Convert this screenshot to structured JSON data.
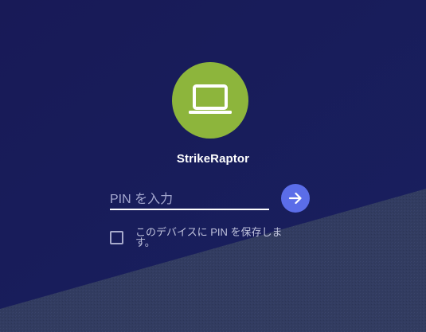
{
  "colors": {
    "background_top": "#181b5a",
    "background_bottom": "#323c60",
    "avatar": "#8db53c",
    "accent": "#5b6de8",
    "text": "#ffffff"
  },
  "user": {
    "avatar_icon": "laptop-icon",
    "name": "StrikeRaptor"
  },
  "pin": {
    "placeholder": "PIN を入力",
    "value": ""
  },
  "submit": {
    "icon": "arrow-right-icon"
  },
  "remember": {
    "checked": false,
    "label": "このデバイスに PIN を保存します。"
  }
}
